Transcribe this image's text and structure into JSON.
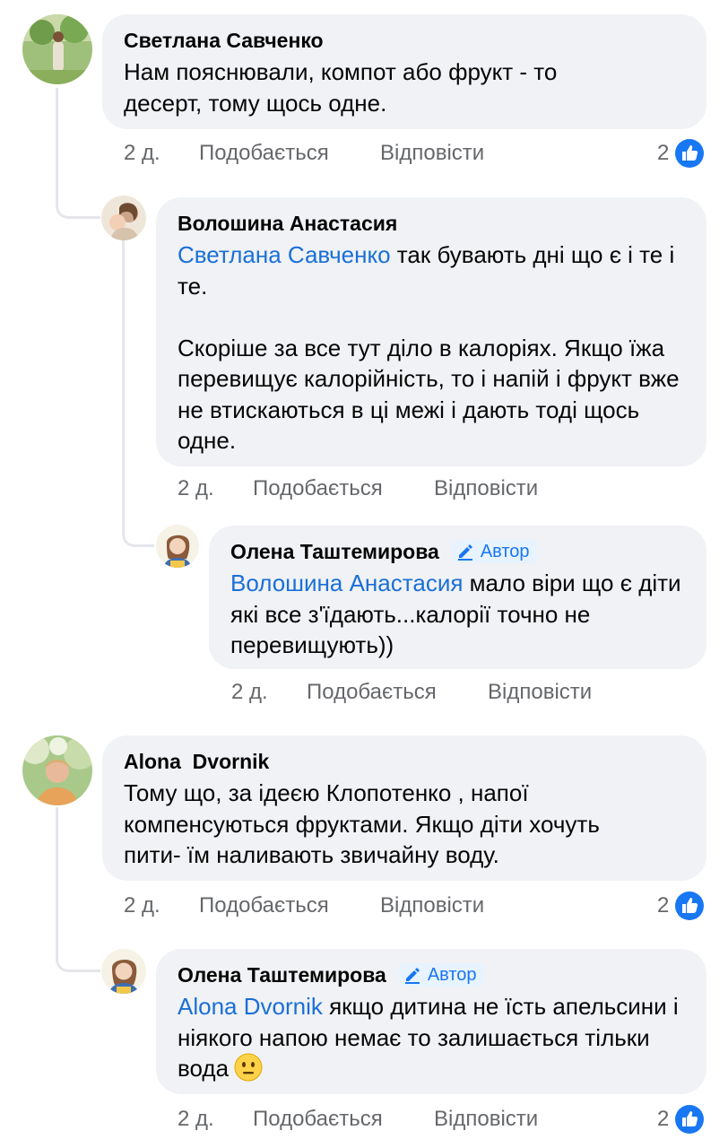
{
  "colors": {
    "bubble_bg": "#f0f2f5",
    "mention": "#1a6fd8",
    "meta_text": "#65676b",
    "like_blue": "#1877f2",
    "author_badge_bg": "#e7f3ff"
  },
  "comments": [
    {
      "author": "Светлана Савченко",
      "lines": [
        "Нам пояснювали, компот або фрукт - то",
        "десерт, тому щось одне."
      ],
      "age": "2 д.",
      "like_label": "Подобається",
      "reply_label": "Відповісти",
      "reaction_count": "2",
      "reaction_icon": "like-thumb-icon"
    },
    {
      "author": "Волошина Анастасия",
      "mention": "Светлана Савченко",
      "text_after_mention": " так бувають дні що є і те і те.",
      "paragraph2": "Скоріше за все тут діло в калоріях. Якщо їжа перевищує калорійність, то і напій і фрукт вже не втискаються в ці межі і дають тоді щось одне.",
      "age": "2 д.",
      "like_label": "Подобається",
      "reply_label": "Відповісти"
    },
    {
      "author": "Олена Таштемирова",
      "badge": "Автор",
      "badge_icon": "pencil-icon",
      "mention": "Волошина Анастасия",
      "text_after_mention": " мало віри що є діти які все з'їдають...калорії точно не перевищують))",
      "age": "2 д.",
      "like_label": "Подобається",
      "reply_label": "Відповісти"
    },
    {
      "author": "Alona  Dvornik",
      "lines": [
        "Тому що, за ідеєю Клопотенко , напої",
        "компенсуються фруктами. Якщо діти хочуть",
        "пити- їм наливають звичайну воду."
      ],
      "age": "2 д.",
      "like_label": "Подобається",
      "reply_label": "Відповісти",
      "reaction_count": "2",
      "reaction_icon": "like-thumb-icon"
    },
    {
      "author": "Олена Таштемирова",
      "badge": "Автор",
      "badge_icon": "pencil-icon",
      "mention": "Alona Dvornik",
      "text_after_mention": " якщо дитина  не їсть апельсини і ніякого напою немає то залишається тільки вода",
      "emoji": "neutral-face-emoji",
      "age": "2 д.",
      "like_label": "Подобається",
      "reply_label": "Відповісти",
      "reaction_count": "2",
      "reaction_icon": "like-thumb-icon"
    }
  ]
}
